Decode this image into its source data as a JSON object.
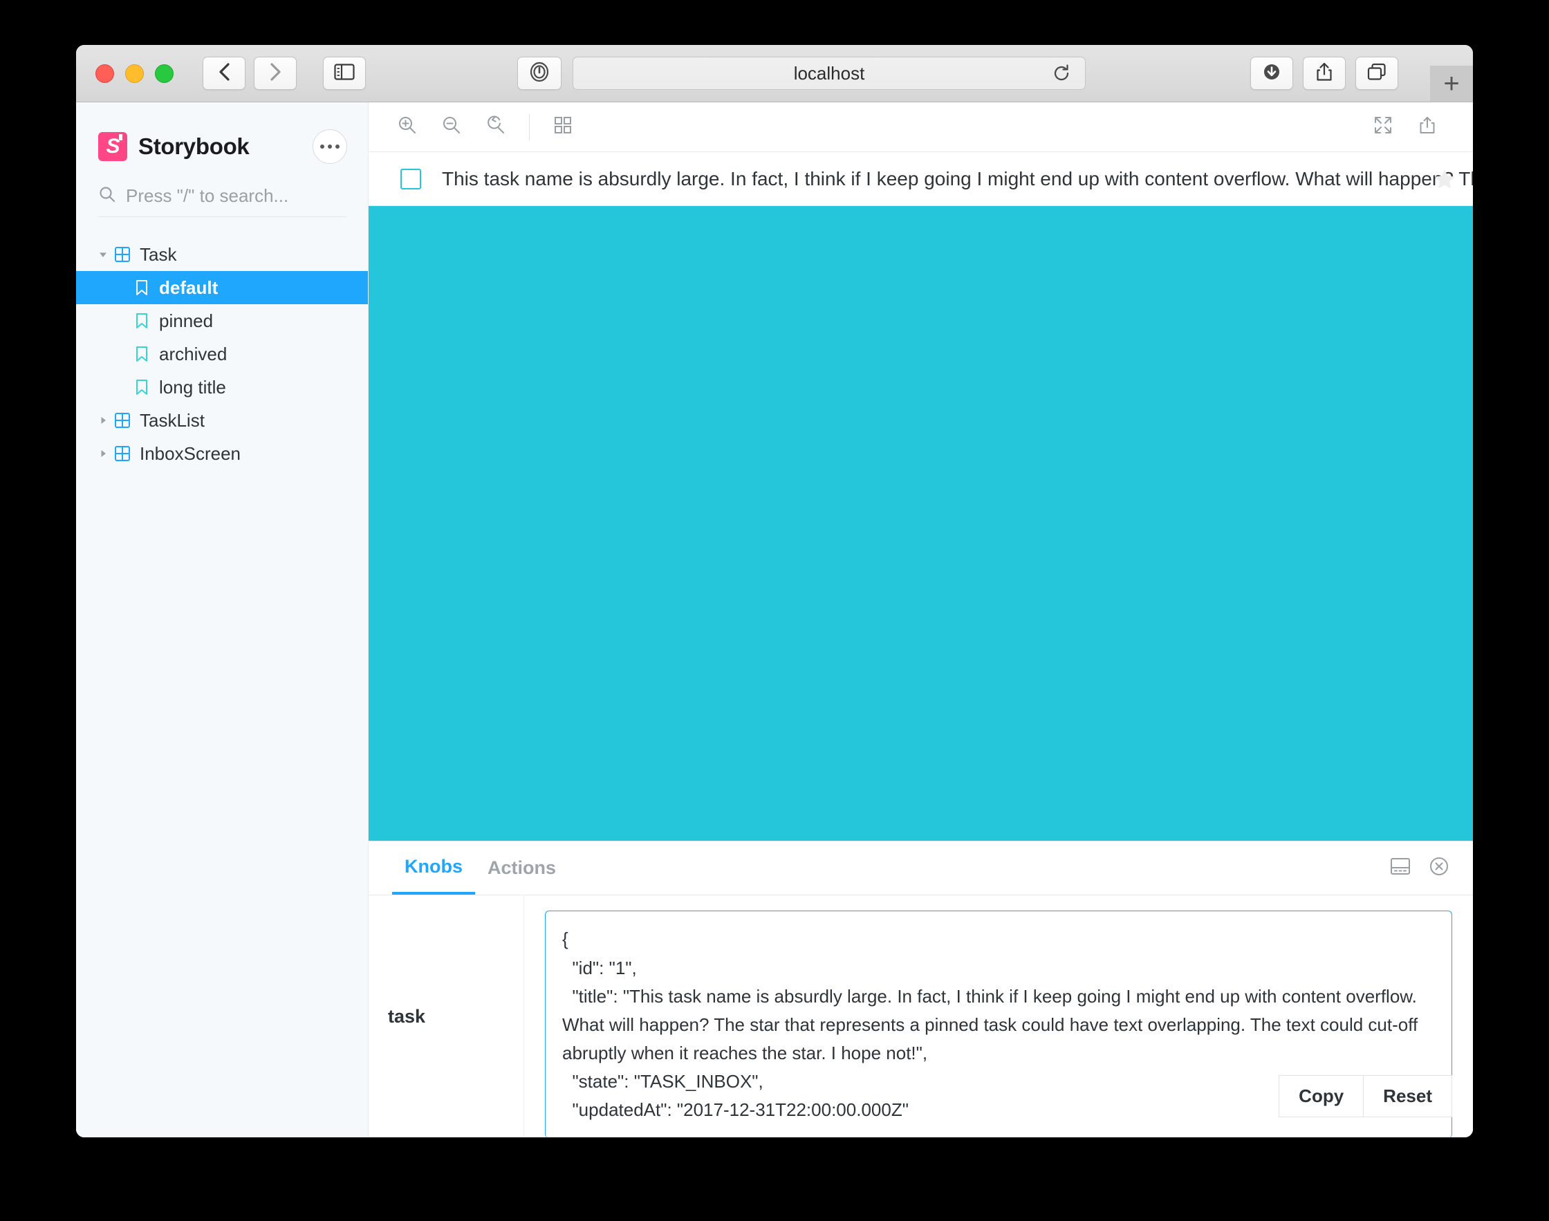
{
  "browser": {
    "url": "localhost",
    "new_tab_label": "+",
    "icons": {
      "back": "back-chevron-icon",
      "forward": "forward-chevron-icon",
      "sidebar": "sidebar-toggle-icon",
      "password": "password-manager-icon",
      "reload": "reload-icon",
      "downloads": "downloads-icon",
      "share": "share-icon",
      "tabs": "tab-overview-icon"
    }
  },
  "sidebar": {
    "brand": "Storybook",
    "logo_letter": "S",
    "menu_icon": "more-options-icon",
    "search": {
      "placeholder": "Press \"/\" to search...",
      "icon": "search-icon"
    },
    "tree": [
      {
        "label": "Task",
        "type": "component",
        "expanded": true,
        "selected": false,
        "level": 0
      },
      {
        "label": "default",
        "type": "story",
        "expanded": false,
        "selected": true,
        "level": 1
      },
      {
        "label": "pinned",
        "type": "story",
        "expanded": false,
        "selected": false,
        "level": 1
      },
      {
        "label": "archived",
        "type": "story",
        "expanded": false,
        "selected": false,
        "level": 1
      },
      {
        "label": "long title",
        "type": "story",
        "expanded": false,
        "selected": false,
        "level": 1
      },
      {
        "label": "TaskList",
        "type": "component",
        "expanded": false,
        "selected": false,
        "level": 0
      },
      {
        "label": "InboxScreen",
        "type": "component",
        "expanded": false,
        "selected": false,
        "level": 0
      }
    ]
  },
  "preview_toolbar": {
    "zoom_in": "zoom-in-icon",
    "zoom_out": "zoom-out-icon",
    "zoom_reset": "zoom-reset-icon",
    "grid": "grid-background-icon",
    "fullscreen": "fullscreen-icon",
    "open_new_tab": "open-in-new-tab-icon"
  },
  "story_preview": {
    "task_title": "This task name is absurdly large. In fact, I think if I keep going I might end up with content overflow. What will happen? The star that represents a pinned task could have text overlapping. The text could cut-off abruptly when it reaches the star. I hope not!",
    "checkbox_checked": false,
    "star_state": "unpinned",
    "canvas_color": "#26c6da"
  },
  "panel": {
    "tabs": [
      {
        "label": "Knobs",
        "active": true
      },
      {
        "label": "Actions",
        "active": false
      }
    ],
    "position_icon": "panel-position-icon",
    "close_icon": "close-panel-icon",
    "knob": {
      "name": "task",
      "value": "{\n  \"id\": \"1\",\n  \"title\": \"This task name is absurdly large. In fact, I think if I keep going I might end up with content overflow. What will happen? The star that represents a pinned task could have text overlapping. The text could cut-off abruptly when it reaches the star. I hope not!\",\n  \"state\": \"TASK_INBOX\",\n  \"updatedAt\": \"2017-12-31T22:00:00.000Z\"",
      "copy_label": "Copy",
      "reset_label": "Reset"
    }
  },
  "colors": {
    "brand_pink": "#ff4785",
    "accent_blue": "#1ea7fd",
    "teal": "#26c6da",
    "sidebar_bg": "#f6f9fc"
  }
}
